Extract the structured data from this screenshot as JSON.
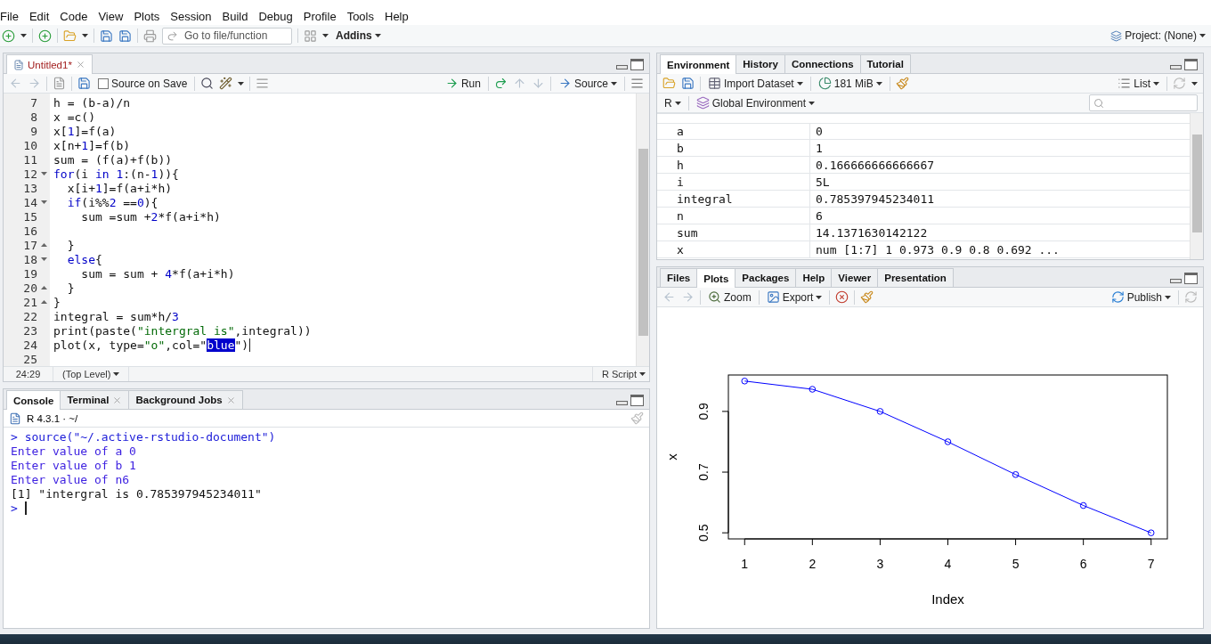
{
  "menu": [
    "File",
    "Edit",
    "Code",
    "View",
    "Plots",
    "Session",
    "Build",
    "Debug",
    "Profile",
    "Tools",
    "Help"
  ],
  "toolbar": {
    "go_to": {
      "placeholder": "Go to file/function"
    },
    "addins": "Addins",
    "project": "Project: (None)"
  },
  "editor": {
    "tabs": [
      {
        "label": "Untitled1*",
        "selected": true,
        "modified": true
      }
    ],
    "toolbar": {
      "source_on_save": {
        "label": "Source on Save",
        "checked": false
      },
      "run": "Run",
      "source": "Source"
    },
    "lines": [
      {
        "number": "7",
        "segments": [
          {
            "kind": "plain",
            "text": "h = (b-a)/n"
          }
        ]
      },
      {
        "number": "8",
        "segments": [
          {
            "kind": "plain",
            "text": "x =c()"
          }
        ]
      },
      {
        "number": "9",
        "segments": [
          {
            "kind": "plain",
            "text": "x["
          },
          {
            "kind": "number",
            "text": "1"
          },
          {
            "kind": "plain",
            "text": "]=f(a)"
          }
        ]
      },
      {
        "number": "10",
        "segments": [
          {
            "kind": "plain",
            "text": "x[n+"
          },
          {
            "kind": "number",
            "text": "1"
          },
          {
            "kind": "plain",
            "text": "]=f(b)"
          }
        ]
      },
      {
        "number": "11",
        "segments": [
          {
            "kind": "plain",
            "text": "sum = (f(a)+f(b))"
          }
        ]
      },
      {
        "number": "12",
        "fold_start": true,
        "segments": [
          {
            "kind": "keyword",
            "text": "for"
          },
          {
            "kind": "plain",
            "text": "(i "
          },
          {
            "kind": "keyword",
            "text": "in"
          },
          {
            "kind": "number",
            "text": " 1"
          },
          {
            "kind": "plain",
            "text": ":(n-"
          },
          {
            "kind": "number",
            "text": "1"
          },
          {
            "kind": "plain",
            "text": ")){"
          }
        ]
      },
      {
        "number": "13",
        "segments": [
          {
            "kind": "plain",
            "text": "  x[i+"
          },
          {
            "kind": "number",
            "text": "1"
          },
          {
            "kind": "plain",
            "text": "]=f(a+i*h)"
          }
        ]
      },
      {
        "number": "14",
        "fold_start": true,
        "segments": [
          {
            "kind": "keyword",
            "text": "  if"
          },
          {
            "kind": "plain",
            "text": "(i%%"
          },
          {
            "kind": "number",
            "text": "2"
          },
          {
            "kind": "plain",
            "text": " =="
          },
          {
            "kind": "number",
            "text": "0"
          },
          {
            "kind": "plain",
            "text": "){"
          }
        ]
      },
      {
        "number": "15",
        "segments": [
          {
            "kind": "plain",
            "text": "    sum =sum +"
          },
          {
            "kind": "number",
            "text": "2"
          },
          {
            "kind": "plain",
            "text": "*f(a+i*h)"
          }
        ]
      },
      {
        "number": "16"
      },
      {
        "number": "17",
        "fold_end": true,
        "segments": [
          {
            "kind": "plain",
            "text": "  }"
          }
        ]
      },
      {
        "number": "18",
        "fold_start": true,
        "segments": [
          {
            "kind": "keyword",
            "text": "  else"
          },
          {
            "kind": "plain",
            "text": "{"
          }
        ]
      },
      {
        "number": "19",
        "segments": [
          {
            "kind": "plain",
            "text": "    sum = sum + "
          },
          {
            "kind": "number",
            "text": "4"
          },
          {
            "kind": "plain",
            "text": "*f(a+i*h)"
          }
        ]
      },
      {
        "number": "20",
        "fold_end": true,
        "segments": [
          {
            "kind": "plain",
            "text": "  }"
          }
        ]
      },
      {
        "number": "21",
        "fold_end": true,
        "segments": [
          {
            "kind": "plain",
            "text": "}"
          }
        ]
      },
      {
        "number": "22",
        "segments": [
          {
            "kind": "plain",
            "text": "integral = sum*h/"
          },
          {
            "kind": "number",
            "text": "3"
          }
        ]
      },
      {
        "number": "23",
        "segments": [
          {
            "kind": "plain",
            "text": "print(paste("
          },
          {
            "kind": "string",
            "text": "\"intergral is\""
          },
          {
            "kind": "plain",
            "text": ",integral))"
          }
        ]
      },
      {
        "number": "24",
        "cursor": true,
        "segments": [
          {
            "kind": "plain",
            "text": "plot(x, type="
          },
          {
            "kind": "string",
            "text": "\"o\""
          },
          {
            "kind": "plain",
            "text": ",col=\""
          },
          {
            "kind": "selected",
            "text": "blue"
          },
          {
            "kind": "plain",
            "text": "\")"
          }
        ]
      },
      {
        "number": "25"
      }
    ],
    "status": {
      "position": "24:29",
      "scope": "(Top Level)",
      "file_type": "R Script"
    }
  },
  "console": {
    "tabs": [
      {
        "label": "Console",
        "selected": true,
        "closable": false
      },
      {
        "label": "Terminal",
        "selected": false,
        "closable": true
      },
      {
        "label": "Background Jobs",
        "selected": false,
        "closable": true
      }
    ],
    "session": "R 4.3.1 · ~/",
    "lines": [
      {
        "kind": "input",
        "prompt": ">",
        "text": "source(\"~/.active-rstudio-document\")"
      },
      {
        "kind": "echo",
        "text": "Enter value of a 0"
      },
      {
        "kind": "echo",
        "text": "Enter value of b 1"
      },
      {
        "kind": "echo",
        "text": "Enter value of n6"
      },
      {
        "kind": "output",
        "text": "[1] \"intergral is 0.785397945234011\""
      }
    ],
    "prompt": ">"
  },
  "environment": {
    "tabs": [
      {
        "label": "Environment",
        "selected": true
      },
      {
        "label": "History",
        "selected": false
      },
      {
        "label": "Connections",
        "selected": false
      },
      {
        "label": "Tutorial",
        "selected": false
      }
    ],
    "toolbar": {
      "import": "Import Dataset",
      "memory": "181 MiB",
      "view": "List"
    },
    "language": "R",
    "scope": "Global Environment",
    "rows": [
      {
        "name": "a",
        "value": "0"
      },
      {
        "name": "b",
        "value": "1"
      },
      {
        "name": "h",
        "value": "0.166666666666667"
      },
      {
        "name": "i",
        "value": "5L"
      },
      {
        "name": "integral",
        "value": "0.785397945234011"
      },
      {
        "name": "n",
        "value": "6"
      },
      {
        "name": "sum",
        "value": "14.1371630142122"
      },
      {
        "name": "x",
        "value": "num [1:7] 1 0.973 0.9 0.8 0.692 ..."
      }
    ]
  },
  "plots": {
    "tabs": [
      {
        "label": "Files",
        "selected": false
      },
      {
        "label": "Plots",
        "selected": true
      },
      {
        "label": "Packages",
        "selected": false
      },
      {
        "label": "Help",
        "selected": false
      },
      {
        "label": "Viewer",
        "selected": false
      },
      {
        "label": "Presentation",
        "selected": false
      }
    ],
    "toolbar": {
      "zoom": "Zoom",
      "export": "Export",
      "publish": "Publish"
    },
    "chart_data": {
      "type": "line",
      "xlabel": "Index",
      "ylabel": "x",
      "x": [
        1,
        2,
        3,
        4,
        5,
        6,
        7
      ],
      "series": [
        {
          "color": "#0000ff",
          "marker": "circle",
          "values": [
            1,
            0.973,
            0.9,
            0.8,
            0.692,
            0.59,
            0.5
          ]
        }
      ],
      "xlim": [
        0.76,
        7.24
      ],
      "ylim": [
        0.48,
        1.02
      ],
      "xticks": [
        1,
        2,
        3,
        4,
        5,
        6,
        7
      ],
      "yticks": [
        0.5,
        0.7,
        0.9
      ]
    }
  }
}
